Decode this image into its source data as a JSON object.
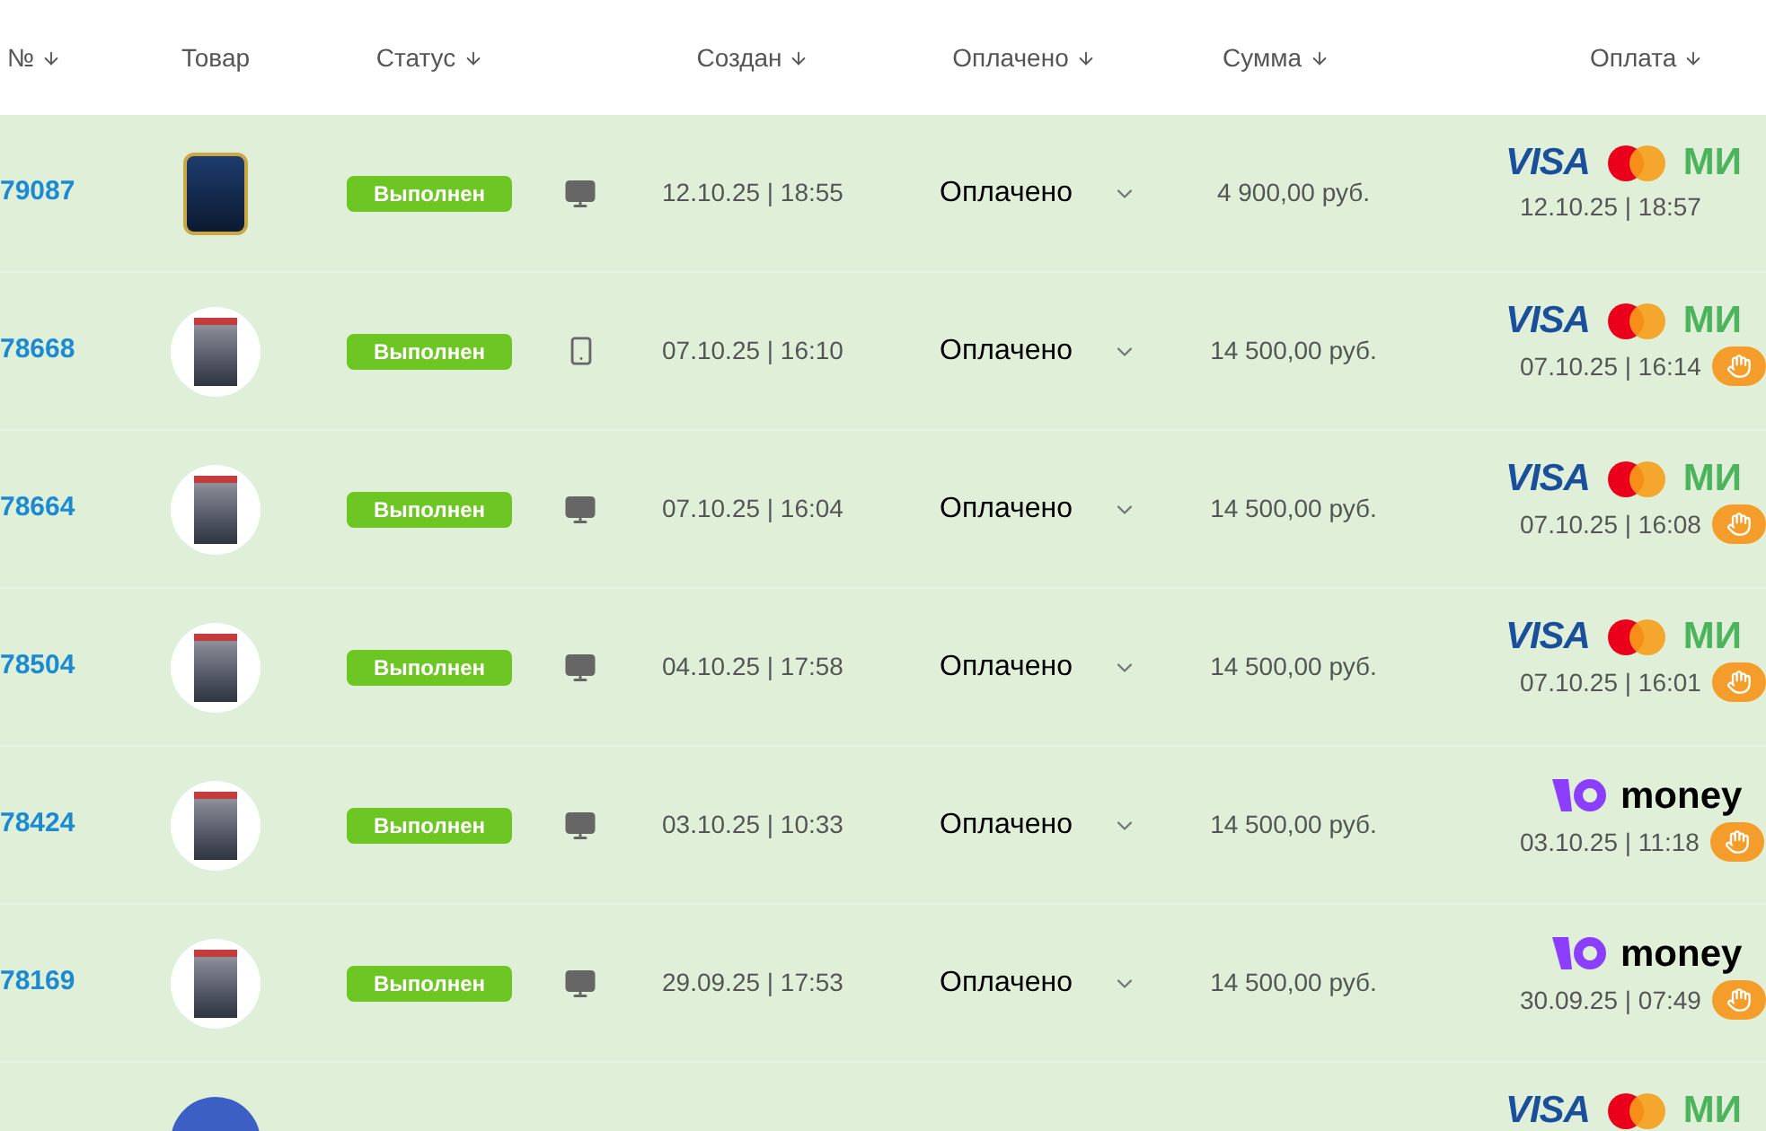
{
  "table": {
    "columns": [
      {
        "label": "№",
        "sortable": true
      },
      {
        "label": "Товар",
        "sortable": false
      },
      {
        "label": "Статус",
        "sortable": true
      },
      {
        "label": "Создан",
        "sortable": true
      },
      {
        "label": "Оплачено",
        "sortable": true
      },
      {
        "label": "Сумма",
        "sortable": true
      },
      {
        "label": "Оплата",
        "sortable": true
      }
    ],
    "rows": [
      {
        "number": "79087",
        "product": {
          "kind": "box"
        },
        "status": "Выполнен",
        "device": {
          "kind": "desktop"
        },
        "created": "12.10.25 | 18:55",
        "paid": "Оплачено",
        "amount": "4 900,00 руб.",
        "payment": {
          "kind": "cards",
          "logos": [
            "VISA",
            "МИ"
          ],
          "date": "12.10.25 | 18:57",
          "manual": false
        }
      },
      {
        "number": "78668",
        "product": {
          "kind": "book"
        },
        "status": "Выполнен",
        "device": {
          "kind": "mobile"
        },
        "created": "07.10.25 | 16:10",
        "paid": "Оплачено",
        "amount": "14 500,00 руб.",
        "payment": {
          "kind": "cards",
          "logos": [
            "VISA",
            "МИ"
          ],
          "date": "07.10.25 | 16:14",
          "manual": true
        }
      },
      {
        "number": "78664",
        "product": {
          "kind": "book"
        },
        "status": "Выполнен",
        "device": {
          "kind": "desktop"
        },
        "created": "07.10.25 | 16:04",
        "paid": "Оплачено",
        "amount": "14 500,00 руб.",
        "payment": {
          "kind": "cards",
          "logos": [
            "VISA",
            "МИ"
          ],
          "date": "07.10.25 | 16:08",
          "manual": true
        }
      },
      {
        "number": "78504",
        "product": {
          "kind": "book"
        },
        "status": "Выполнен",
        "device": {
          "kind": "desktop"
        },
        "created": "04.10.25 | 17:58",
        "paid": "Оплачено",
        "amount": "14 500,00 руб.",
        "payment": {
          "kind": "cards",
          "logos": [
            "VISA",
            "МИ"
          ],
          "date": "07.10.25 | 16:01",
          "manual": true
        }
      },
      {
        "number": "78424",
        "product": {
          "kind": "book"
        },
        "status": "Выполнен",
        "device": {
          "kind": "desktop"
        },
        "created": "03.10.25 | 10:33",
        "paid": "Оплачено",
        "amount": "14 500,00 руб.",
        "payment": {
          "kind": "wallet",
          "logos": [
            "money"
          ],
          "date": "03.10.25 | 11:18",
          "manual": true
        }
      },
      {
        "number": "78169",
        "product": {
          "kind": "book"
        },
        "status": "Выполнен",
        "device": {
          "kind": "desktop"
        },
        "created": "29.09.25 | 17:53",
        "paid": "Оплачено",
        "amount": "14 500,00 руб.",
        "payment": {
          "kind": "wallet",
          "logos": [
            "money"
          ],
          "date": "30.09.25 | 07:49",
          "manual": true
        }
      },
      {
        "product": {
          "kind": "disc"
        },
        "payment": {
          "kind": "cards",
          "logos": [
            "VISA",
            "МИ"
          ]
        }
      }
    ]
  }
}
